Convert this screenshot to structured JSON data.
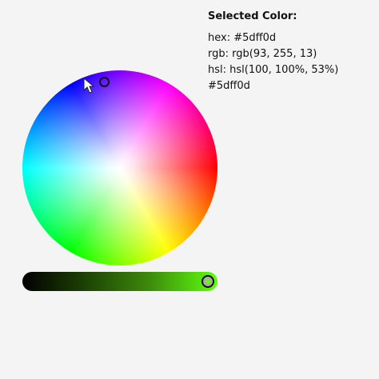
{
  "panel": {
    "title": "Selected Color:",
    "hex_line": "hex: #5dff0d",
    "rgb_line": "rgb: rgb(93, 255, 13)",
    "hsl_line": "hsl: hsl(100, 100%, 53%)",
    "plain_hex": "#5dff0d"
  },
  "selected_color": "#5dff0d",
  "value_slider": {
    "level": 1.0
  },
  "icons": {
    "cursor": "arrow-cursor-icon"
  }
}
